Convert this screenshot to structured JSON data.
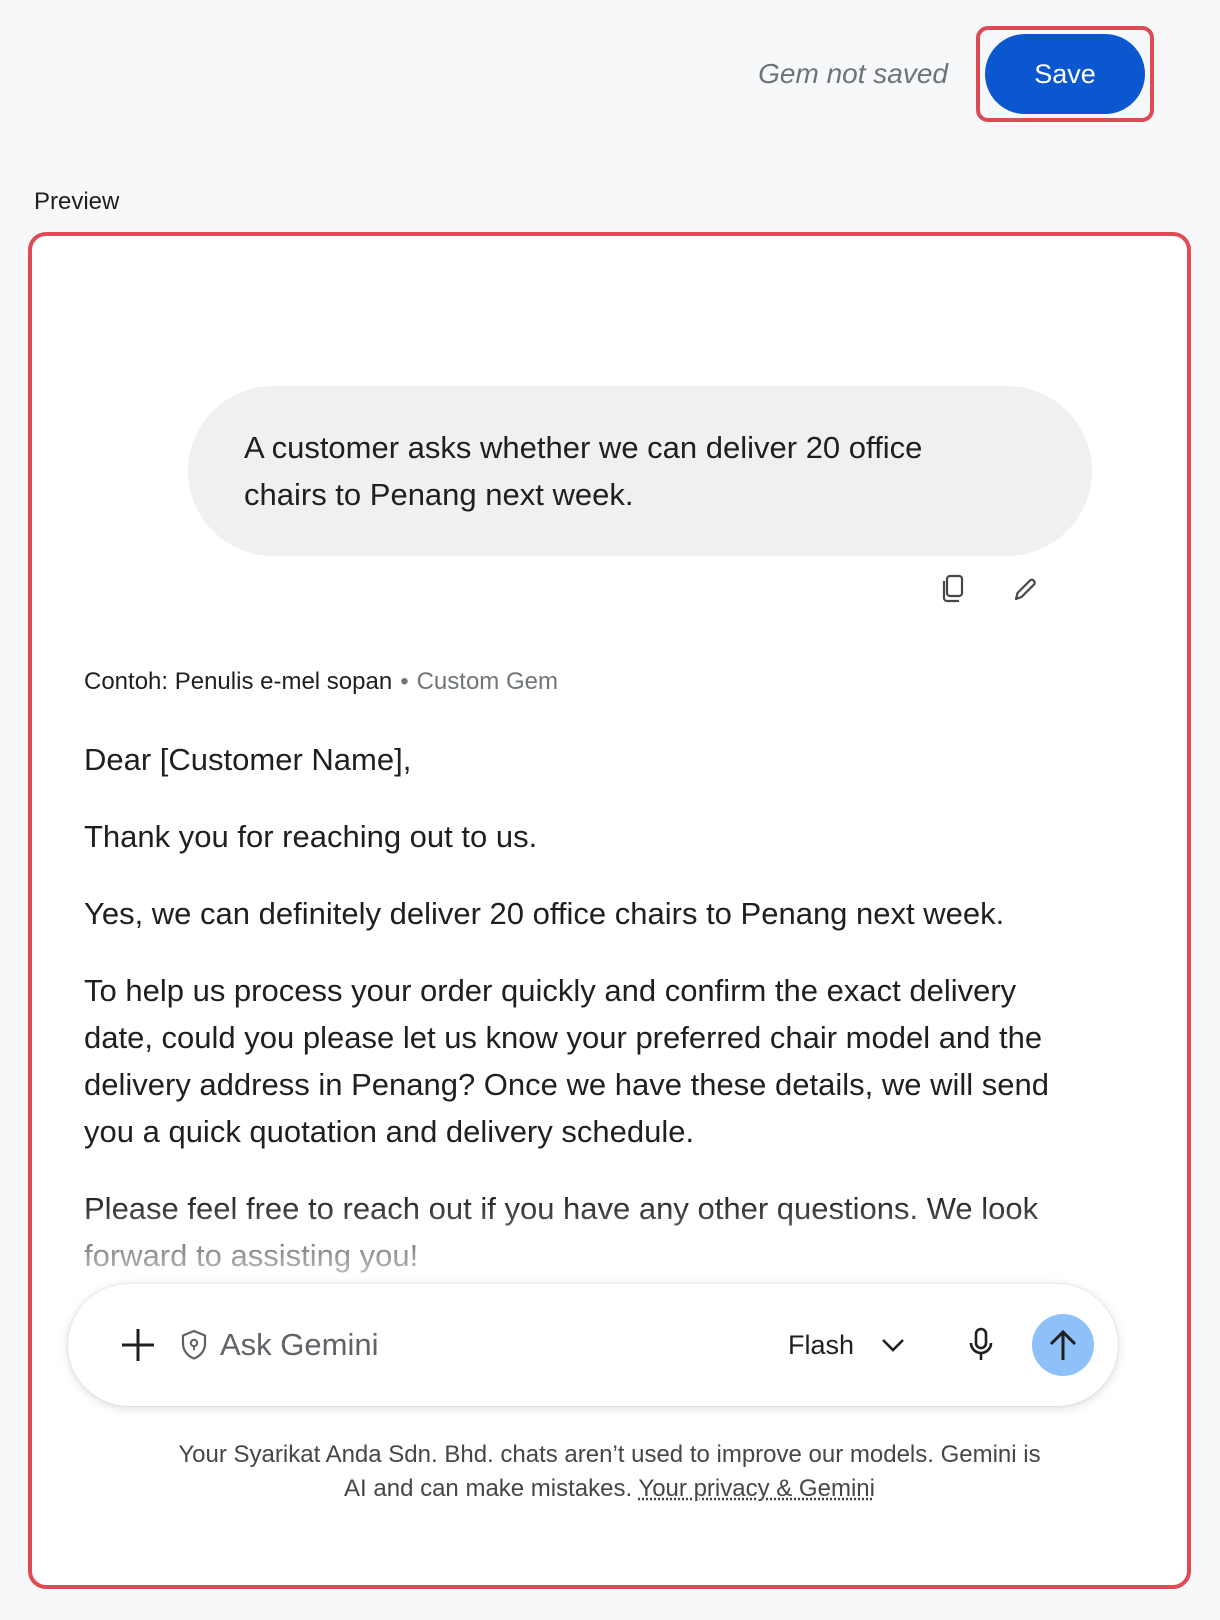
{
  "header": {
    "status_text": "Gem not saved",
    "save_label": "Save"
  },
  "preview": {
    "label": "Preview",
    "user_message": {
      "line1": "A customer asks whether we can deliver 20 office",
      "line2": "chairs to Penang next week."
    },
    "message_actions": {
      "copy_icon": "copy-icon",
      "edit_icon": "edit-icon"
    },
    "byline": {
      "name": "Contoh: Penulis e-mel sopan",
      "separator": "•",
      "type": "Custom Gem"
    },
    "response": {
      "greeting": "Dear [Customer Name],",
      "p1": "Thank you for reaching out to us.",
      "p2": "Yes, we can definitely deliver 20 office chairs to Penang next week.",
      "p3_l1": "To help us process your order quickly and confirm the exact delivery",
      "p3_l2": "date, could you please let us know your preferred chair model and the",
      "p3_l3": "delivery address in Penang? Once we have these details, we will send",
      "p3_l4": "you a quick quotation and delivery schedule.",
      "p4_l1": "Please feel free to reach out if you have any other questions. We look",
      "p4_l2": "forward to assisting you!"
    },
    "input": {
      "placeholder": "Ask Gemini",
      "model": "Flash",
      "icons": [
        "plus-icon",
        "shield-icon",
        "chevron-down-icon",
        "mic-icon",
        "arrow-up-icon"
      ]
    },
    "footer": {
      "line1": "Your Syarikat Anda Sdn. Bhd. chats aren’t used to improve our models. Gemini is",
      "line2_text": "AI and can make mistakes. ",
      "link": "Your privacy & Gemini"
    }
  },
  "colors": {
    "accent": "#0b57d0",
    "highlight_border": "#e04a55",
    "send_button": "#8ec1f9",
    "bubble": "#f1efef"
  }
}
